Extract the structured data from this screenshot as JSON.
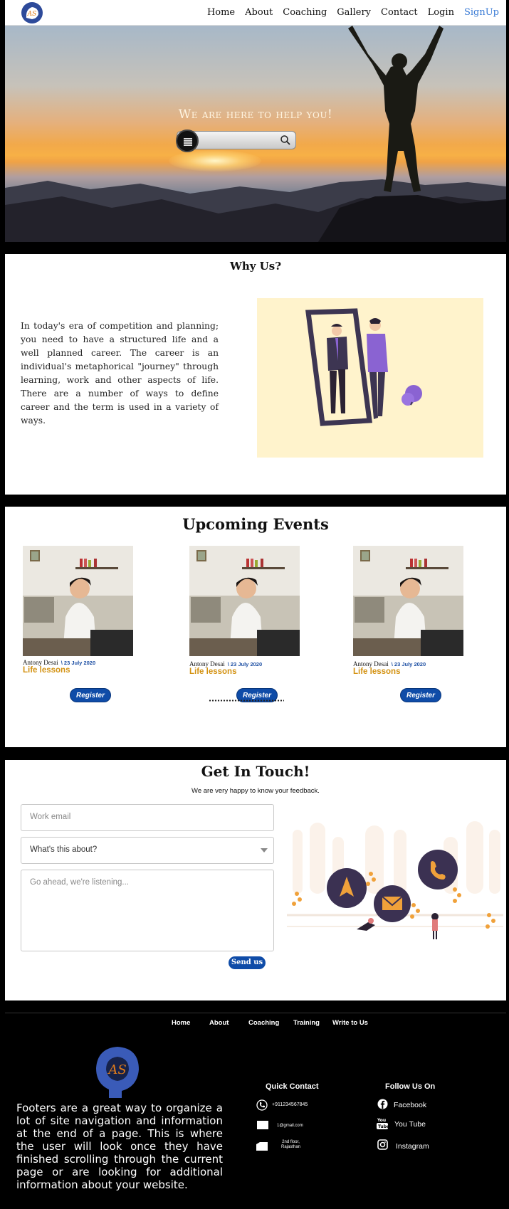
{
  "nav": {
    "links": [
      "Home",
      "About",
      "Coaching",
      "Gallery",
      "Contact",
      "Login"
    ],
    "signup": "SignUp",
    "logo_text": "AS"
  },
  "hero": {
    "title": "We are here to help you!",
    "search_placeholder": ""
  },
  "why": {
    "title": "Why Us?",
    "text": "In today's era of competition and planning; you need to have a structured life and a well planned career. The career is an individual's metaphorical \"journey\" through learning, work and other aspects of life. There are a number of ways to define career and the term is used in a variety of ways."
  },
  "events": {
    "title": "Upcoming Events",
    "cards": [
      {
        "author": "Antony Desai",
        "date": "23 July 2020",
        "topic": "Life lessons",
        "button": "Register"
      },
      {
        "author": "Antony Desai",
        "date": "23 July 2020",
        "topic": "Life lessons",
        "button": "Register"
      },
      {
        "author": "Antony Desai",
        "date": "23 July 2020",
        "topic": "Life lessons",
        "button": "Register"
      }
    ]
  },
  "contact": {
    "title": "Get In Touch!",
    "subtitle": "We are very happy to know your feedback.",
    "email_placeholder": "Work email",
    "topic_value": "What's this about?",
    "message_placeholder": "Go ahead, we're listening...",
    "send": "Send us"
  },
  "footer": {
    "links": [
      "Home",
      "About",
      "Coaching",
      "Training",
      "Write to Us"
    ],
    "logo_text": "AS",
    "description": "Footers are a great way to organize a lot of site navigation and information at the end of a page. This is where the user will look once they have finished scrolling through the current page or are looking for additional information about your website.",
    "quick_contact": {
      "title": "Quick Contact",
      "phone": "+911234567845",
      "email": "1@gmail.com",
      "address_line1": "2nd floor,",
      "address_line2": "Rajasthan"
    },
    "follow": {
      "title": "Follow Us On",
      "facebook": "Facebook",
      "youtube": "You Tube",
      "instagram": "Instagram"
    }
  },
  "colors": {
    "accent_blue": "#0f4ca8",
    "signup_blue": "#3a7bd5",
    "topic_gold": "#d39212",
    "illustration_bg": "#fff3cc",
    "illustration_purple": "#8a63d2"
  }
}
